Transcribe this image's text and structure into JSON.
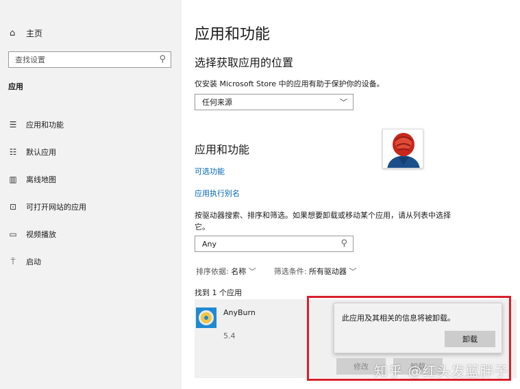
{
  "sidebar": {
    "home_label": "主页",
    "search_placeholder": "查找设置",
    "section_label": "应用",
    "items": [
      {
        "label": "应用和功能"
      },
      {
        "label": "默认应用"
      },
      {
        "label": "离线地图"
      },
      {
        "label": "可打开网站的应用"
      },
      {
        "label": "视频播放"
      },
      {
        "label": "启动"
      }
    ]
  },
  "main": {
    "title": "应用和功能",
    "install_heading": "选择获取应用的位置",
    "install_desc": "仅安装 Microsoft Store 中的应用有助于保护你的设备。",
    "install_source": "任何来源",
    "apps_heading": "应用和功能",
    "link_optional": "可选功能",
    "link_alias": "应用执行别名",
    "search_desc": "按驱动器搜索、排序和筛选。如果想要卸载或移动某个应用，请从列表中选择它。",
    "search_value": "Any",
    "sort_label": "排序依据:",
    "sort_value": "名称",
    "filter_label": "筛选条件:",
    "filter_value": "所有驱动器",
    "found_text": "找到 1 个应用",
    "app": {
      "name": "AnyBurn",
      "version": "5.4",
      "modify_label": "修改",
      "uninstall_label": "卸载"
    }
  },
  "popup": {
    "message": "此应用及其相关的信息将被卸载。",
    "button": "卸载"
  },
  "watermark": "知乎 @红头发蓝胖子",
  "colors": {
    "sidebar_bg": "#f2f2f2",
    "link": "#0067b8",
    "highlight": "#d8202a",
    "app_icon_bg": "#1f8ad1"
  }
}
